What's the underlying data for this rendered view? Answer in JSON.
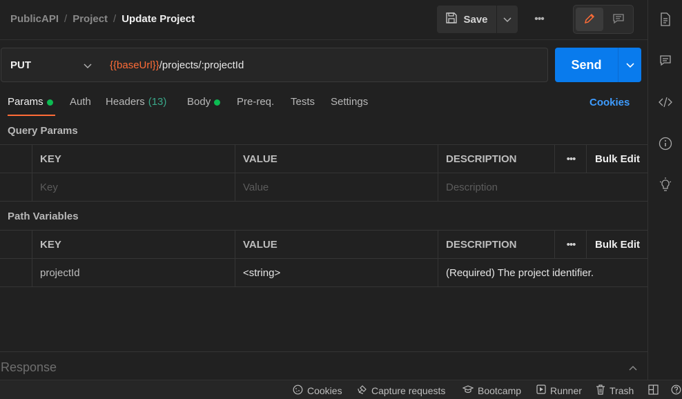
{
  "breadcrumb": {
    "items": [
      "PublicAPI",
      "Project"
    ],
    "separator": "/",
    "current": "Update Project"
  },
  "toolbar": {
    "save_label": "Save",
    "more_label": "•••"
  },
  "request": {
    "method": "PUT",
    "url_variable": "{{baseUrl}}",
    "url_path": "/projects/:projectId",
    "send_label": "Send"
  },
  "tabs": {
    "params": "Params",
    "auth": "Auth",
    "headers": "Headers",
    "headers_count": "(13)",
    "body": "Body",
    "prereq": "Pre-req.",
    "tests": "Tests",
    "settings": "Settings",
    "cookies": "Cookies"
  },
  "query_params": {
    "title": "Query Params",
    "columns": {
      "key": "KEY",
      "value": "VALUE",
      "description": "DESCRIPTION",
      "more": "•••",
      "bulk_edit": "Bulk Edit"
    },
    "placeholder": {
      "key": "Key",
      "value": "Value",
      "description": "Description"
    }
  },
  "path_variables": {
    "title": "Path Variables",
    "columns": {
      "key": "KEY",
      "value": "VALUE",
      "description": "DESCRIPTION",
      "more": "•••",
      "bulk_edit": "Bulk Edit"
    },
    "rows": [
      {
        "key": "projectId",
        "value": "<string>",
        "description": "(Required) The project identifier."
      }
    ]
  },
  "response": {
    "label": "Response"
  },
  "statusbar": {
    "cookies": "Cookies",
    "capture": "Capture requests",
    "bootcamp": "Bootcamp",
    "runner": "Runner",
    "trash": "Trash"
  },
  "colors": {
    "accent": "#ff6c37",
    "send": "#097bed",
    "link": "#3e9cff",
    "dot": "#0cbb52"
  }
}
